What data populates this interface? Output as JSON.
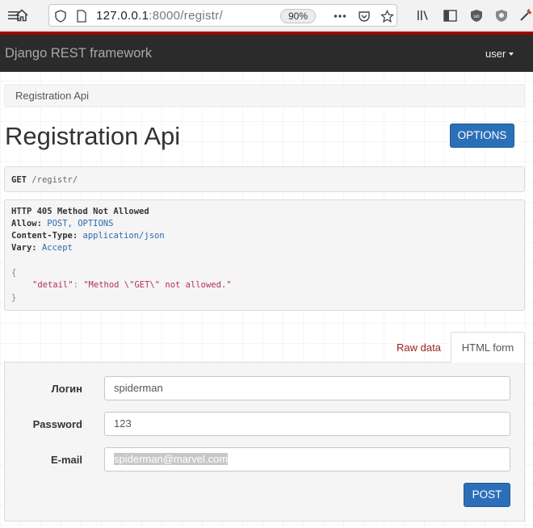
{
  "browser": {
    "url_host": "127.0.0.1",
    "url_rest": ":8000/registr/",
    "zoom": "90%"
  },
  "navbar": {
    "brand": "Django REST framework",
    "user": "user"
  },
  "breadcrumb": "Registration Api",
  "page": {
    "title": "Registration Api",
    "options_label": "OPTIONS"
  },
  "request": {
    "method": "GET",
    "path": "/registr/"
  },
  "response": {
    "status": "HTTP 405 Method Not Allowed",
    "headers": [
      {
        "name": "Allow:",
        "value": "POST, OPTIONS"
      },
      {
        "name": "Content-Type:",
        "value": "application/json"
      },
      {
        "name": "Vary:",
        "value": "Accept"
      }
    ],
    "open_brace": "{",
    "body_key": "\"detail\"",
    "body_sep": ": ",
    "body_value": "\"Method \\\"GET\\\" not allowed.\"",
    "close_brace": "}"
  },
  "tabs": {
    "raw": "Raw data",
    "html_form": "HTML form"
  },
  "form": {
    "fields": [
      {
        "label": "Логин",
        "value": "spiderman"
      },
      {
        "label": "Password",
        "value": "123"
      },
      {
        "label": "E-mail",
        "value": "spiderman@marvel.com"
      }
    ],
    "submit": "POST"
  }
}
